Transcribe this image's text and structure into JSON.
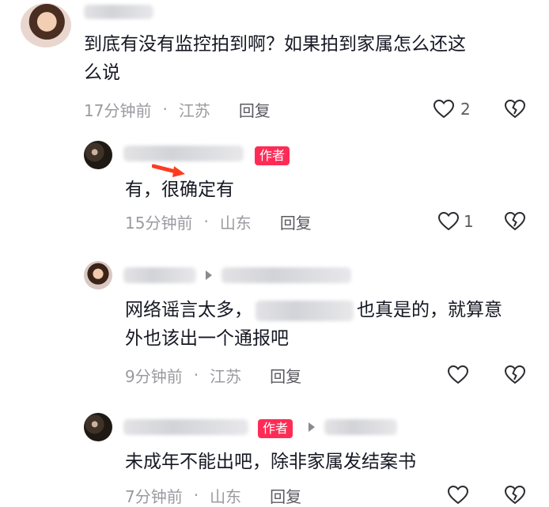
{
  "comments": [
    {
      "text_line1": "到底有没有监控拍到啊？如果拍到家属怎么还这",
      "text_line2": "么说",
      "time": "17分钟前",
      "location": "江苏",
      "reply": "回复",
      "likes": "2"
    },
    {
      "tag": "作者",
      "text_line1": "有，很确定有",
      "time": "15分钟前",
      "location": "山东",
      "reply": "回复",
      "likes": "1"
    },
    {
      "text_line1a": "网络谣言太多，",
      "text_line1b": "也真是的，就算意",
      "text_line2": "外也该出一个通报吧",
      "time": "9分钟前",
      "location": "江苏",
      "reply": "回复",
      "likes": ""
    },
    {
      "tag": "作者",
      "text_line1": "未成年不能出吧，除非家属发结案书",
      "time": "7分钟前",
      "location": "山东",
      "reply": "回复",
      "likes": ""
    }
  ],
  "separator": "·",
  "colors": {
    "accent": "#fe2c55",
    "meta": "#9a9aa0",
    "text": "#161823"
  },
  "icons": [
    "heart-icon",
    "broken-heart-icon",
    "reply-arrow-icon",
    "red-arrow-annotation"
  ]
}
